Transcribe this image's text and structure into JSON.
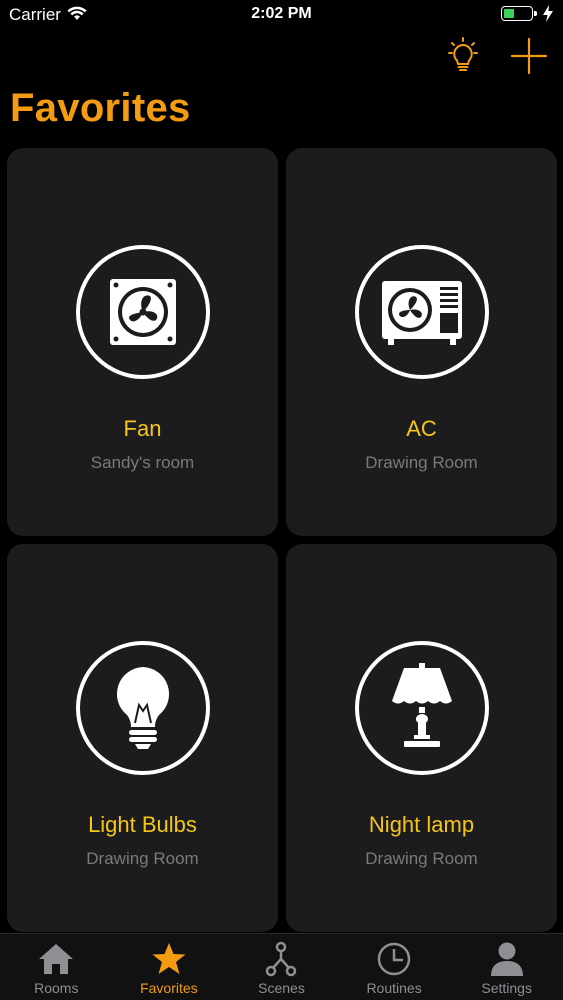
{
  "status": {
    "carrier": "Carrier",
    "time": "2:02 PM",
    "battery_level": 0.4
  },
  "header": {
    "title": "Favorites"
  },
  "favorites": [
    {
      "name": "Fan",
      "room": "Sandy's room",
      "icon": "fan-icon"
    },
    {
      "name": "AC",
      "room": "Drawing Room",
      "icon": "ac-icon"
    },
    {
      "name": "Light Bulbs",
      "room": "Drawing Room",
      "icon": "bulb-icon"
    },
    {
      "name": "Night lamp",
      "room": "Drawing Room",
      "icon": "lamp-icon"
    }
  ],
  "tabs": [
    {
      "label": "Rooms",
      "icon": "home-icon",
      "active": false
    },
    {
      "label": "Favorites",
      "icon": "star-icon",
      "active": true
    },
    {
      "label": "Scenes",
      "icon": "nodes-icon",
      "active": false
    },
    {
      "label": "Routines",
      "icon": "clock-icon",
      "active": false
    },
    {
      "label": "Settings",
      "icon": "user-icon",
      "active": false
    }
  ],
  "colors": {
    "accent": "#f39c12",
    "device_name": "#f5c518",
    "card_bg": "#1c1c1e",
    "background": "#000000"
  }
}
